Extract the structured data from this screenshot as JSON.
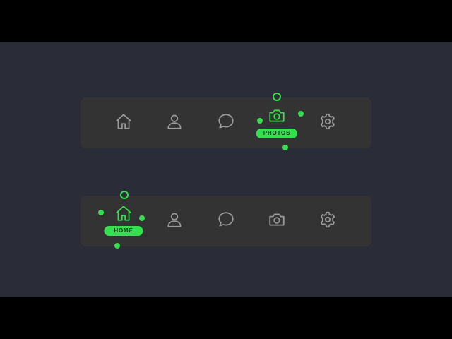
{
  "colors": {
    "background": "#2a2d38",
    "bar": "#333334",
    "accent": "#35e04e",
    "icon": "#9b9b9b"
  },
  "navbar_top": {
    "active": "photos",
    "items": [
      {
        "icon": "home-icon"
      },
      {
        "icon": "user-icon"
      },
      {
        "icon": "chat-icon"
      },
      {
        "icon": "camera-icon",
        "label": "PHOTOS"
      },
      {
        "icon": "gear-icon"
      }
    ]
  },
  "navbar_bottom": {
    "active": "home",
    "items": [
      {
        "icon": "home-icon",
        "label": "HOME"
      },
      {
        "icon": "user-icon"
      },
      {
        "icon": "chat-icon"
      },
      {
        "icon": "camera-icon"
      },
      {
        "icon": "gear-icon"
      }
    ]
  }
}
